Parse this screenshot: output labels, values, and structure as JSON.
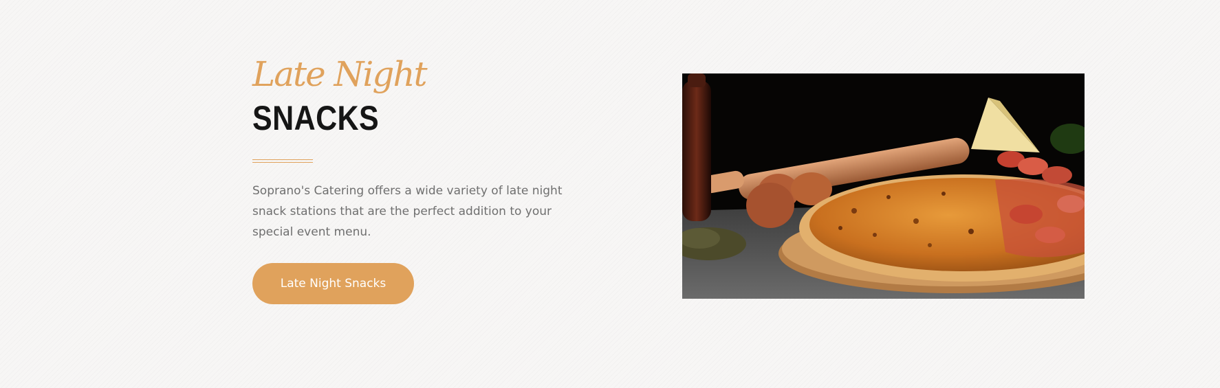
{
  "section": {
    "script_title": "Late Night",
    "title": "SNACKS",
    "description": "Soprano's Catering offers a wide variety of late night snack stations that are the perfect addition to your special event menu.",
    "button_label": "Late Night Snacks"
  },
  "colors": {
    "accent": "#e0a25c",
    "title": "#161616",
    "body_text": "#6f6f6f",
    "background": "#f7f6f5"
  },
  "image": {
    "subject": "pizza-photo"
  }
}
